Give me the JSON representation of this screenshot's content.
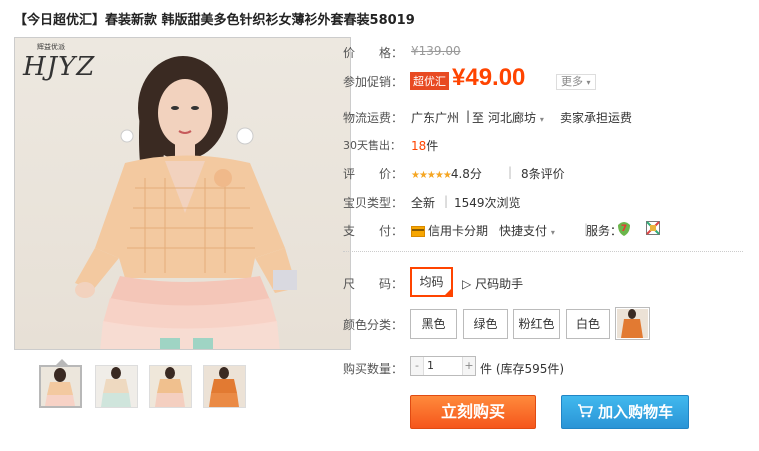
{
  "title": "【今日超优汇】春装新款 韩版甜美多色针织衫女薄衫外套春装58019",
  "logo": {
    "small": "辉益优派",
    "big": "HJYZ"
  },
  "price": {
    "label": "价　　格：",
    "original": "¥139.00"
  },
  "promo": {
    "label": "参加促销：",
    "badge": "超优汇",
    "price": "¥49.00",
    "more": "更多"
  },
  "shipping": {
    "label": "物流运费：",
    "from": "广东广州",
    "sep1": "至",
    "to": "河北廊坊",
    "note": "卖家承担运费"
  },
  "sold": {
    "label": "30天售出：",
    "count": "18",
    "unit": "件"
  },
  "rating": {
    "label": "评　　价：",
    "stars": "★★★★★",
    "score": "4.8分",
    "reviews": "8条评价"
  },
  "type": {
    "label": "宝贝类型：",
    "condition": "全新",
    "views": "1549次浏览"
  },
  "pay": {
    "label": "支　　付：",
    "credit": "信用卡分期",
    "quick": "快捷支付",
    "service_label": "服务："
  },
  "size": {
    "label": "尺　　码：",
    "selected": "均码",
    "helper": "尺码助手"
  },
  "color": {
    "label": "颜色分类：",
    "options": [
      "黑色",
      "绿色",
      "粉红色",
      "白色"
    ]
  },
  "quantity": {
    "label": "购买数量：",
    "value": "1",
    "stock": "件 (库存595件)"
  },
  "buttons": {
    "buy": "立刻购买",
    "cart": "加入购物车"
  }
}
